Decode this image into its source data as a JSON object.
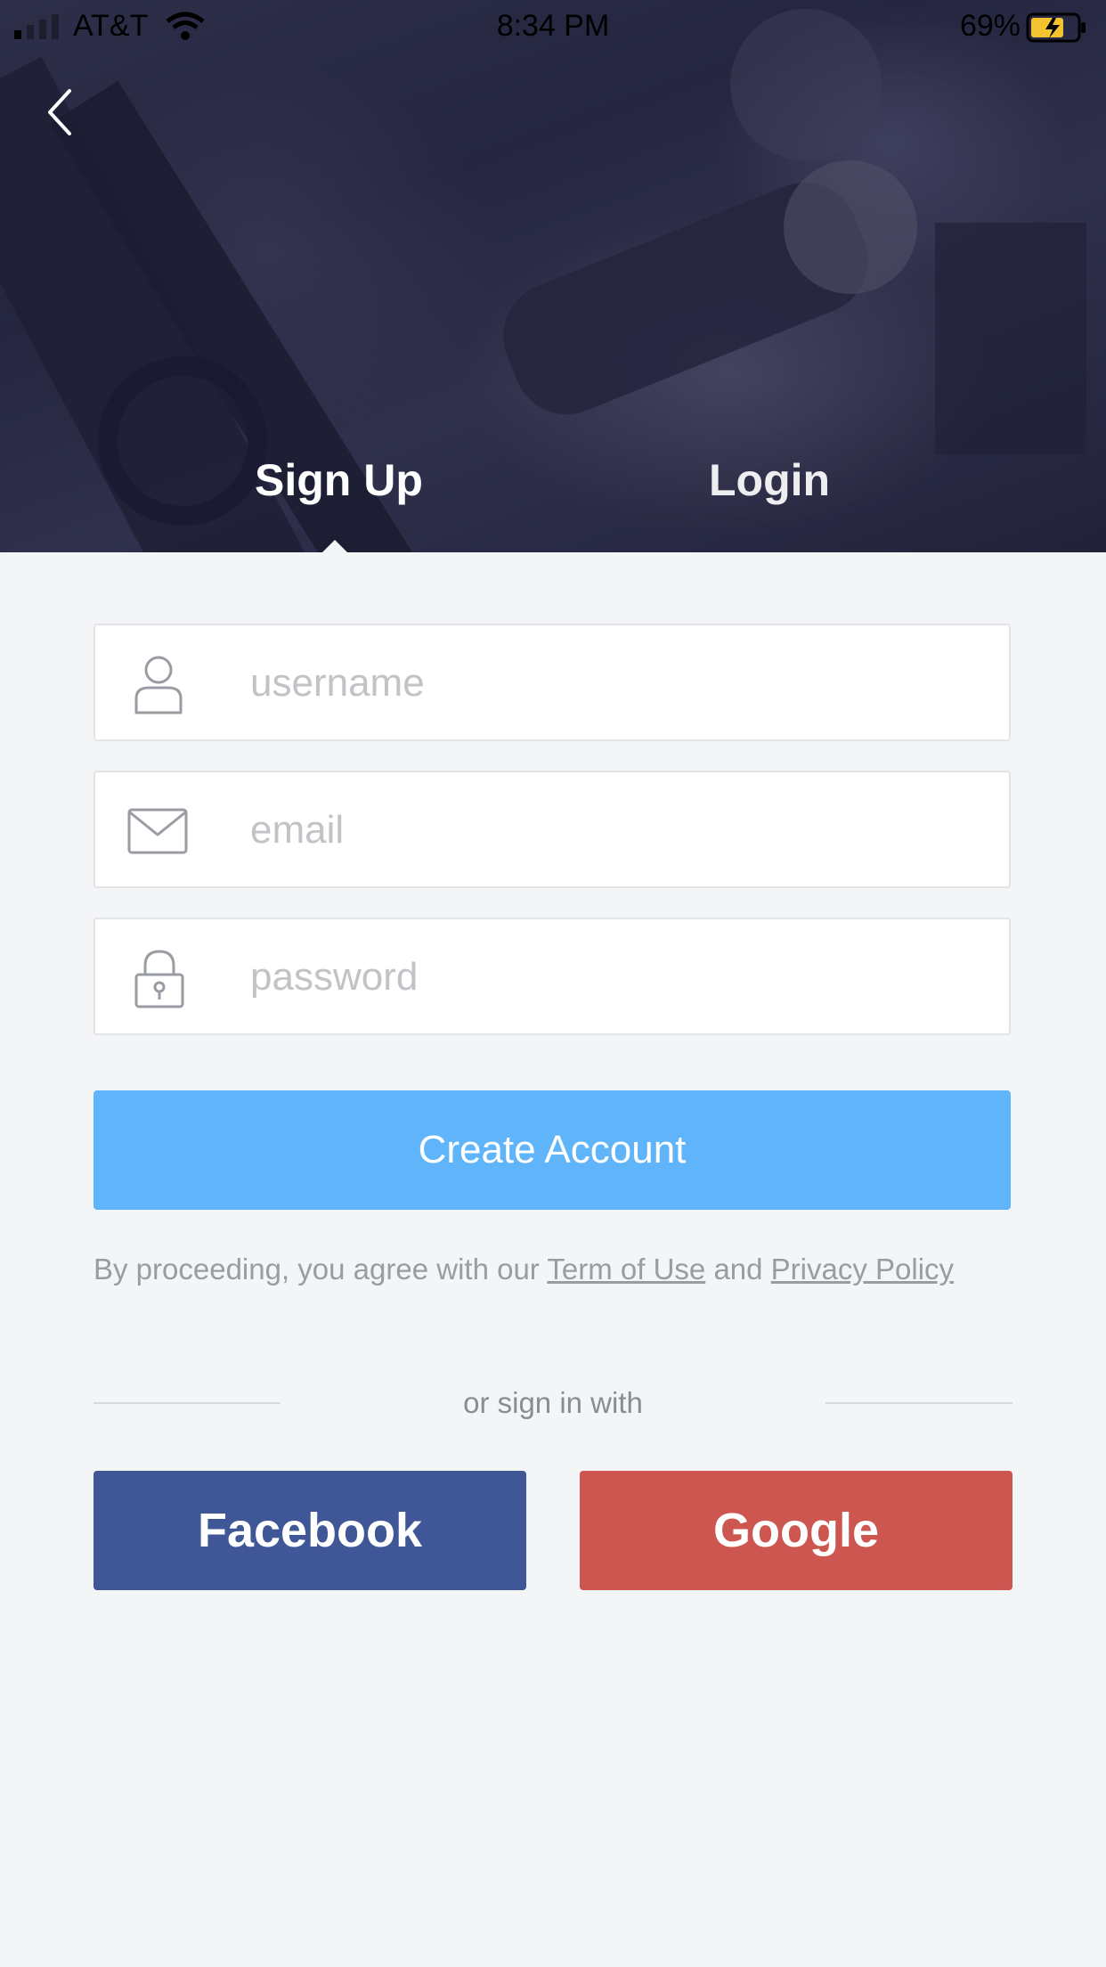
{
  "status_bar": {
    "carrier": "AT&T",
    "time": "8:34 PM",
    "battery_percent": "69%"
  },
  "tabs": {
    "signup_label": "Sign Up",
    "login_label": "Login",
    "active": "Sign Up"
  },
  "form": {
    "username_placeholder": "username",
    "email_placeholder": "email",
    "password_placeholder": "password",
    "username_value": "",
    "email_value": "",
    "password_value": ""
  },
  "create_button_label": "Create Account",
  "terms": {
    "prefix": "By proceeding, you agree with our",
    "terms_link": "Term of Use",
    "conjunction": "and",
    "privacy_link": "Privacy Policy"
  },
  "divider_text": "or sign in with",
  "social": {
    "facebook_label": "Facebook",
    "google_label": "Google"
  },
  "colors": {
    "accent": "#60b5fa",
    "facebook": "#3f5797",
    "google": "#cd5650",
    "background": "#f4f5f7"
  },
  "icons": {
    "back": "chevron-left-icon",
    "username": "user-icon",
    "email": "mail-icon",
    "password": "lock-icon"
  }
}
